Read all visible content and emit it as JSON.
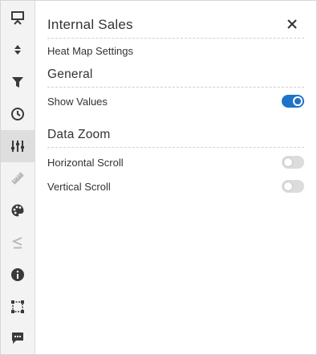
{
  "panel": {
    "title": "Internal Sales",
    "subtitle": "Heat Map Settings",
    "close_icon": "close-icon"
  },
  "sections": {
    "general": {
      "heading": "General",
      "show_values": {
        "label": "Show Values",
        "enabled": true
      }
    },
    "data_zoom": {
      "heading": "Data Zoom",
      "horizontal_scroll": {
        "label": "Horizontal Scroll",
        "enabled": false
      },
      "vertical_scroll": {
        "label": "Vertical Scroll",
        "enabled": false
      }
    }
  },
  "sidebar": {
    "items": [
      {
        "icon": "presentation-icon",
        "active": false
      },
      {
        "icon": "sort-icon",
        "active": false
      },
      {
        "icon": "filter-icon",
        "active": false
      },
      {
        "icon": "clock-icon",
        "active": false
      },
      {
        "icon": "sliders-icon",
        "active": true
      },
      {
        "icon": "ruler-icon",
        "active": false,
        "disabled": true
      },
      {
        "icon": "palette-icon",
        "active": false
      },
      {
        "icon": "less-equal-icon",
        "active": false,
        "disabled": true
      },
      {
        "icon": "info-icon",
        "active": false
      },
      {
        "icon": "selection-icon",
        "active": false
      },
      {
        "icon": "comment-icon",
        "active": false
      }
    ]
  },
  "colors": {
    "accent": "#1e73c8",
    "icon": "#3a3a3a",
    "icon_disabled": "#b9b9b9",
    "rail_bg": "#f3f3f3",
    "rail_active": "#dedede"
  }
}
